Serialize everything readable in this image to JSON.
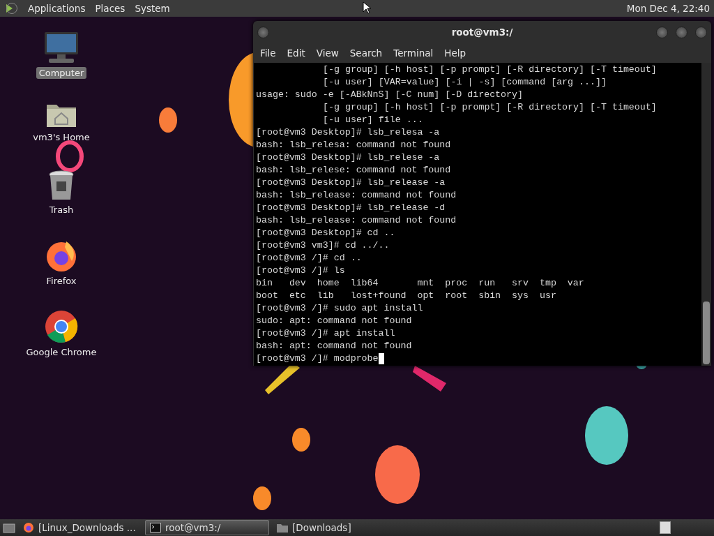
{
  "top_panel": {
    "menus": [
      {
        "label": "Applications"
      },
      {
        "label": "Places"
      },
      {
        "label": "System"
      }
    ],
    "clock": "Mon Dec 4, 22:40"
  },
  "desktop": {
    "wallpaper": {
      "kind": "bubbles"
    },
    "icons": [
      {
        "label": "Computer",
        "kind": "computer",
        "selected": true
      },
      {
        "label": "vm3's Home",
        "kind": "home",
        "selected": false
      },
      {
        "label": "Trash",
        "kind": "trash",
        "selected": false
      },
      {
        "label": "Firefox",
        "kind": "firefox",
        "selected": false
      },
      {
        "label": "Google Chrome",
        "kind": "chrome",
        "selected": false
      }
    ]
  },
  "terminal": {
    "title": "root@vm3:/",
    "menu": [
      {
        "label": "File"
      },
      {
        "label": "Edit"
      },
      {
        "label": "View"
      },
      {
        "label": "Search"
      },
      {
        "label": "Terminal"
      },
      {
        "label": "Help"
      }
    ],
    "cursor": true,
    "lines": [
      {
        "text": "[-g group] [-h host] [-p prompt] [-R directory] [-T timeout]",
        "indented": true
      },
      {
        "text": "[-u user] [VAR=value] [-i | -s] [command [arg ...]]",
        "indented": true
      },
      {
        "text": "usage: sudo -e [-ABkNnS] [-C num] [-D directory]",
        "indented": false
      },
      {
        "text": "[-g group] [-h host] [-p prompt] [-R directory] [-T timeout]",
        "indented": true
      },
      {
        "text": "[-u user] file ...",
        "indented": true
      },
      {
        "text": "[root@vm3 Desktop]# lsb_relesa -a",
        "indented": false
      },
      {
        "text": "bash: lsb_relesa: command not found",
        "indented": false
      },
      {
        "text": "[root@vm3 Desktop]# lsb_relese -a",
        "indented": false
      },
      {
        "text": "bash: lsb_relese: command not found",
        "indented": false
      },
      {
        "text": "[root@vm3 Desktop]# lsb_release -a",
        "indented": false
      },
      {
        "text": "bash: lsb_release: command not found",
        "indented": false
      },
      {
        "text": "[root@vm3 Desktop]# lsb_release -d",
        "indented": false
      },
      {
        "text": "bash: lsb_release: command not found",
        "indented": false
      },
      {
        "text": "[root@vm3 Desktop]# cd ..",
        "indented": false
      },
      {
        "text": "[root@vm3 vm3]# cd ../..",
        "indented": false
      },
      {
        "text": "[root@vm3 /]# cd ..",
        "indented": false
      },
      {
        "text": "[root@vm3 /]# ls",
        "indented": false
      },
      {
        "text": "bin   dev  home  lib64       mnt  proc  run   srv  tmp  var",
        "indented": false
      },
      {
        "text": "boot  etc  lib   lost+found  opt  root  sbin  sys  usr",
        "indented": false
      },
      {
        "text": "[root@vm3 /]# sudo apt install",
        "indented": false
      },
      {
        "text": "sudo: apt: command not found",
        "indented": false
      },
      {
        "text": "[root@vm3 /]# apt install",
        "indented": false
      },
      {
        "text": "bash: apt: command not found",
        "indented": false
      },
      {
        "text": "[root@vm3 /]# modprobe",
        "indented": false
      }
    ]
  },
  "taskbar": {
    "items": [
      {
        "label": "[Linux_Downloads ...",
        "kind": "firefox",
        "selected": false
      },
      {
        "label": "root@vm3:/",
        "kind": "terminal",
        "selected": true
      },
      {
        "label": "[Downloads]",
        "kind": "folder",
        "selected": false
      }
    ]
  }
}
